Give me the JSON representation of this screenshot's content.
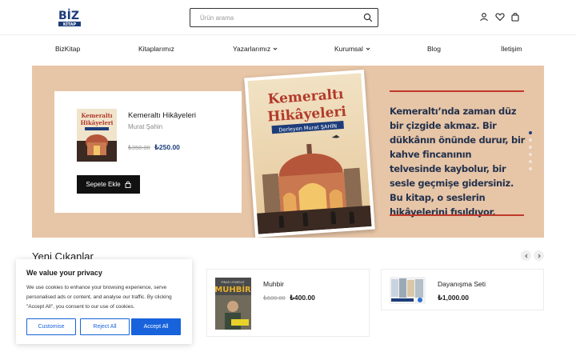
{
  "brand": {
    "logo_text": "BİZ",
    "logo_sub": "KİTAP"
  },
  "search": {
    "placeholder": "Ürün arama"
  },
  "nav": {
    "items": [
      {
        "label": "BizKitap"
      },
      {
        "label": "Kitaplarımız"
      },
      {
        "label": "Yazarlarımız"
      },
      {
        "label": "Kurumsal"
      },
      {
        "label": "Blog"
      },
      {
        "label": "İletişim"
      }
    ]
  },
  "hero": {
    "product": {
      "title": "Kemeraltı Hikâyeleri",
      "author": "Murat Şahin",
      "old_price": "₺350.00",
      "new_price": "₺250.00",
      "cart_label": "Sepete Ekle"
    },
    "cover": {
      "title_line1": "Kemeraltı",
      "title_line2": "Hikâyeleri",
      "subtitle": "Derleyen Murat ŞAHİN"
    },
    "text": "Kemeraltı’nda zaman düz bir çizgide akmaz. Bir dükkânın önünde durur, bir kahve fincanının telvesinde kaybolur, bir sesle geçmişe gidersiniz. Bu kitap, o seslerin hikâyelerini fısıldıyor.",
    "slide_count": 6,
    "active_slide": 1
  },
  "new_releases": {
    "title": "Yeni Çıkanlar",
    "products": [
      {
        "title": "Muhbir",
        "old_price": "₺600.00",
        "new_price": "₺400.00",
        "cover_author": "PINAR UYUMSUZ",
        "cover_title": "MUHBİR"
      },
      {
        "title": "Dayanışma Seti",
        "old_price": "",
        "new_price": "₺1,000.00"
      }
    ]
  },
  "cookie": {
    "title": "We value your privacy",
    "text": "We use cookies to enhance your browsing experience, serve personalised ads or content, and analyse our traffic. By clicking \"Accept All\", you consent to our use of cookies.",
    "customise": "Customise",
    "reject": "Reject All",
    "accept": "Accept All"
  },
  "colors": {
    "hero_bg": "#e7c5a7",
    "price_blue": "#1d3d7a",
    "accent_red": "#c0392b",
    "cookie_blue": "#1863dc"
  }
}
